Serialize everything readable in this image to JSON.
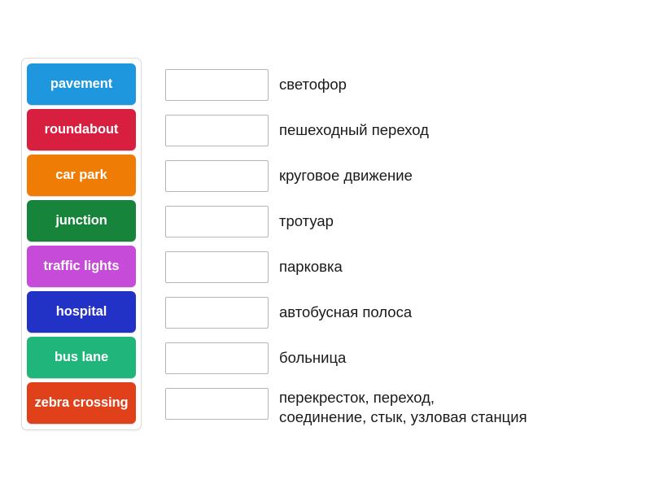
{
  "activity": {
    "type": "match-up-drag-and-drop",
    "background_color": "#ffffff"
  },
  "tile_panel": {
    "name": "draggable-word-tiles",
    "tiles": [
      {
        "label": "pavement",
        "color": "#1f97de"
      },
      {
        "label": "roundabout",
        "color": "#d81f3f"
      },
      {
        "label": "car park",
        "color": "#ef7d05"
      },
      {
        "label": "junction",
        "color": "#16843a"
      },
      {
        "label": "traffic lights",
        "color": "#c64bd8"
      },
      {
        "label": "hospital",
        "color": "#2231c6"
      },
      {
        "label": "bus lane",
        "color": "#20b57b"
      },
      {
        "label": "zebra\ncrossing",
        "color": "#e0401a"
      }
    ]
  },
  "answer_rows": [
    {
      "dropzone_value": "",
      "definition": "светофор"
    },
    {
      "dropzone_value": "",
      "definition": "пешеходный переход"
    },
    {
      "dropzone_value": "",
      "definition": "круговое движение"
    },
    {
      "dropzone_value": "",
      "definition": "тротуар"
    },
    {
      "dropzone_value": "",
      "definition": "парковка"
    },
    {
      "dropzone_value": "",
      "definition": "автобусная полоса"
    },
    {
      "dropzone_value": "",
      "definition": "больница"
    },
    {
      "dropzone_value": "",
      "definition": "перекресток, переход,\nсоединение, стык, узловая станция"
    }
  ]
}
